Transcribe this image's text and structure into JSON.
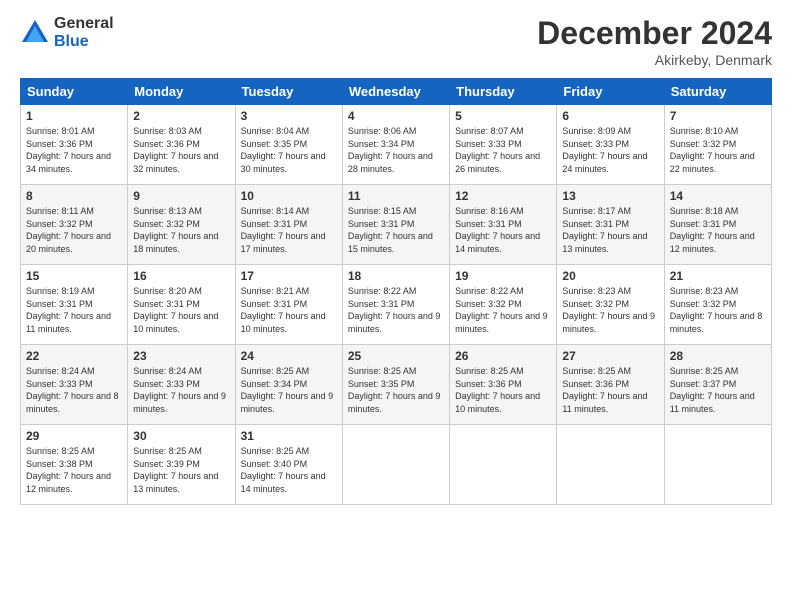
{
  "logo": {
    "general": "General",
    "blue": "Blue"
  },
  "header": {
    "month": "December 2024",
    "location": "Akirkeby, Denmark"
  },
  "weekdays": [
    "Sunday",
    "Monday",
    "Tuesday",
    "Wednesday",
    "Thursday",
    "Friday",
    "Saturday"
  ],
  "weeks": [
    [
      {
        "day": "1",
        "sunrise": "Sunrise: 8:01 AM",
        "sunset": "Sunset: 3:36 PM",
        "daylight": "Daylight: 7 hours and 34 minutes."
      },
      {
        "day": "2",
        "sunrise": "Sunrise: 8:03 AM",
        "sunset": "Sunset: 3:36 PM",
        "daylight": "Daylight: 7 hours and 32 minutes."
      },
      {
        "day": "3",
        "sunrise": "Sunrise: 8:04 AM",
        "sunset": "Sunset: 3:35 PM",
        "daylight": "Daylight: 7 hours and 30 minutes."
      },
      {
        "day": "4",
        "sunrise": "Sunrise: 8:06 AM",
        "sunset": "Sunset: 3:34 PM",
        "daylight": "Daylight: 7 hours and 28 minutes."
      },
      {
        "day": "5",
        "sunrise": "Sunrise: 8:07 AM",
        "sunset": "Sunset: 3:33 PM",
        "daylight": "Daylight: 7 hours and 26 minutes."
      },
      {
        "day": "6",
        "sunrise": "Sunrise: 8:09 AM",
        "sunset": "Sunset: 3:33 PM",
        "daylight": "Daylight: 7 hours and 24 minutes."
      },
      {
        "day": "7",
        "sunrise": "Sunrise: 8:10 AM",
        "sunset": "Sunset: 3:32 PM",
        "daylight": "Daylight: 7 hours and 22 minutes."
      }
    ],
    [
      {
        "day": "8",
        "sunrise": "Sunrise: 8:11 AM",
        "sunset": "Sunset: 3:32 PM",
        "daylight": "Daylight: 7 hours and 20 minutes."
      },
      {
        "day": "9",
        "sunrise": "Sunrise: 8:13 AM",
        "sunset": "Sunset: 3:32 PM",
        "daylight": "Daylight: 7 hours and 18 minutes."
      },
      {
        "day": "10",
        "sunrise": "Sunrise: 8:14 AM",
        "sunset": "Sunset: 3:31 PM",
        "daylight": "Daylight: 7 hours and 17 minutes."
      },
      {
        "day": "11",
        "sunrise": "Sunrise: 8:15 AM",
        "sunset": "Sunset: 3:31 PM",
        "daylight": "Daylight: 7 hours and 15 minutes."
      },
      {
        "day": "12",
        "sunrise": "Sunrise: 8:16 AM",
        "sunset": "Sunset: 3:31 PM",
        "daylight": "Daylight: 7 hours and 14 minutes."
      },
      {
        "day": "13",
        "sunrise": "Sunrise: 8:17 AM",
        "sunset": "Sunset: 3:31 PM",
        "daylight": "Daylight: 7 hours and 13 minutes."
      },
      {
        "day": "14",
        "sunrise": "Sunrise: 8:18 AM",
        "sunset": "Sunset: 3:31 PM",
        "daylight": "Daylight: 7 hours and 12 minutes."
      }
    ],
    [
      {
        "day": "15",
        "sunrise": "Sunrise: 8:19 AM",
        "sunset": "Sunset: 3:31 PM",
        "daylight": "Daylight: 7 hours and 11 minutes."
      },
      {
        "day": "16",
        "sunrise": "Sunrise: 8:20 AM",
        "sunset": "Sunset: 3:31 PM",
        "daylight": "Daylight: 7 hours and 10 minutes."
      },
      {
        "day": "17",
        "sunrise": "Sunrise: 8:21 AM",
        "sunset": "Sunset: 3:31 PM",
        "daylight": "Daylight: 7 hours and 10 minutes."
      },
      {
        "day": "18",
        "sunrise": "Sunrise: 8:22 AM",
        "sunset": "Sunset: 3:31 PM",
        "daylight": "Daylight: 7 hours and 9 minutes."
      },
      {
        "day": "19",
        "sunrise": "Sunrise: 8:22 AM",
        "sunset": "Sunset: 3:32 PM",
        "daylight": "Daylight: 7 hours and 9 minutes."
      },
      {
        "day": "20",
        "sunrise": "Sunrise: 8:23 AM",
        "sunset": "Sunset: 3:32 PM",
        "daylight": "Daylight: 7 hours and 9 minutes."
      },
      {
        "day": "21",
        "sunrise": "Sunrise: 8:23 AM",
        "sunset": "Sunset: 3:32 PM",
        "daylight": "Daylight: 7 hours and 8 minutes."
      }
    ],
    [
      {
        "day": "22",
        "sunrise": "Sunrise: 8:24 AM",
        "sunset": "Sunset: 3:33 PM",
        "daylight": "Daylight: 7 hours and 8 minutes."
      },
      {
        "day": "23",
        "sunrise": "Sunrise: 8:24 AM",
        "sunset": "Sunset: 3:33 PM",
        "daylight": "Daylight: 7 hours and 9 minutes."
      },
      {
        "day": "24",
        "sunrise": "Sunrise: 8:25 AM",
        "sunset": "Sunset: 3:34 PM",
        "daylight": "Daylight: 7 hours and 9 minutes."
      },
      {
        "day": "25",
        "sunrise": "Sunrise: 8:25 AM",
        "sunset": "Sunset: 3:35 PM",
        "daylight": "Daylight: 7 hours and 9 minutes."
      },
      {
        "day": "26",
        "sunrise": "Sunrise: 8:25 AM",
        "sunset": "Sunset: 3:36 PM",
        "daylight": "Daylight: 7 hours and 10 minutes."
      },
      {
        "day": "27",
        "sunrise": "Sunrise: 8:25 AM",
        "sunset": "Sunset: 3:36 PM",
        "daylight": "Daylight: 7 hours and 11 minutes."
      },
      {
        "day": "28",
        "sunrise": "Sunrise: 8:25 AM",
        "sunset": "Sunset: 3:37 PM",
        "daylight": "Daylight: 7 hours and 11 minutes."
      }
    ],
    [
      {
        "day": "29",
        "sunrise": "Sunrise: 8:25 AM",
        "sunset": "Sunset: 3:38 PM",
        "daylight": "Daylight: 7 hours and 12 minutes."
      },
      {
        "day": "30",
        "sunrise": "Sunrise: 8:25 AM",
        "sunset": "Sunset: 3:39 PM",
        "daylight": "Daylight: 7 hours and 13 minutes."
      },
      {
        "day": "31",
        "sunrise": "Sunrise: 8:25 AM",
        "sunset": "Sunset: 3:40 PM",
        "daylight": "Daylight: 7 hours and 14 minutes."
      },
      null,
      null,
      null,
      null
    ]
  ]
}
